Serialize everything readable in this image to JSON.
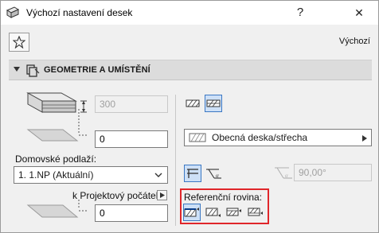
{
  "window": {
    "title": "Výchozí nastavení desek",
    "help_label": "?",
    "close_label": "✕"
  },
  "toolbar": {
    "favorites_icon": "star-icon",
    "default_label": "Výchozí"
  },
  "panel": {
    "title": "GEOMETRIE A UMÍSTĚNÍ"
  },
  "geometry": {
    "thickness_value": "300",
    "offset_value": "0",
    "home_story_label": "Domovské podlaží:",
    "home_story_value": "1. 1.NP (Aktuální)",
    "project_zero_label": "k Projektový počátek",
    "project_zero_value": "0"
  },
  "right": {
    "structure_name": "Obecná deska/střecha",
    "angle_value": "90,00°",
    "reference_label": "Referenční rovina:"
  },
  "colors": {
    "selection_highlight": "#e0262a",
    "selected_btn": "#cde0f7"
  }
}
